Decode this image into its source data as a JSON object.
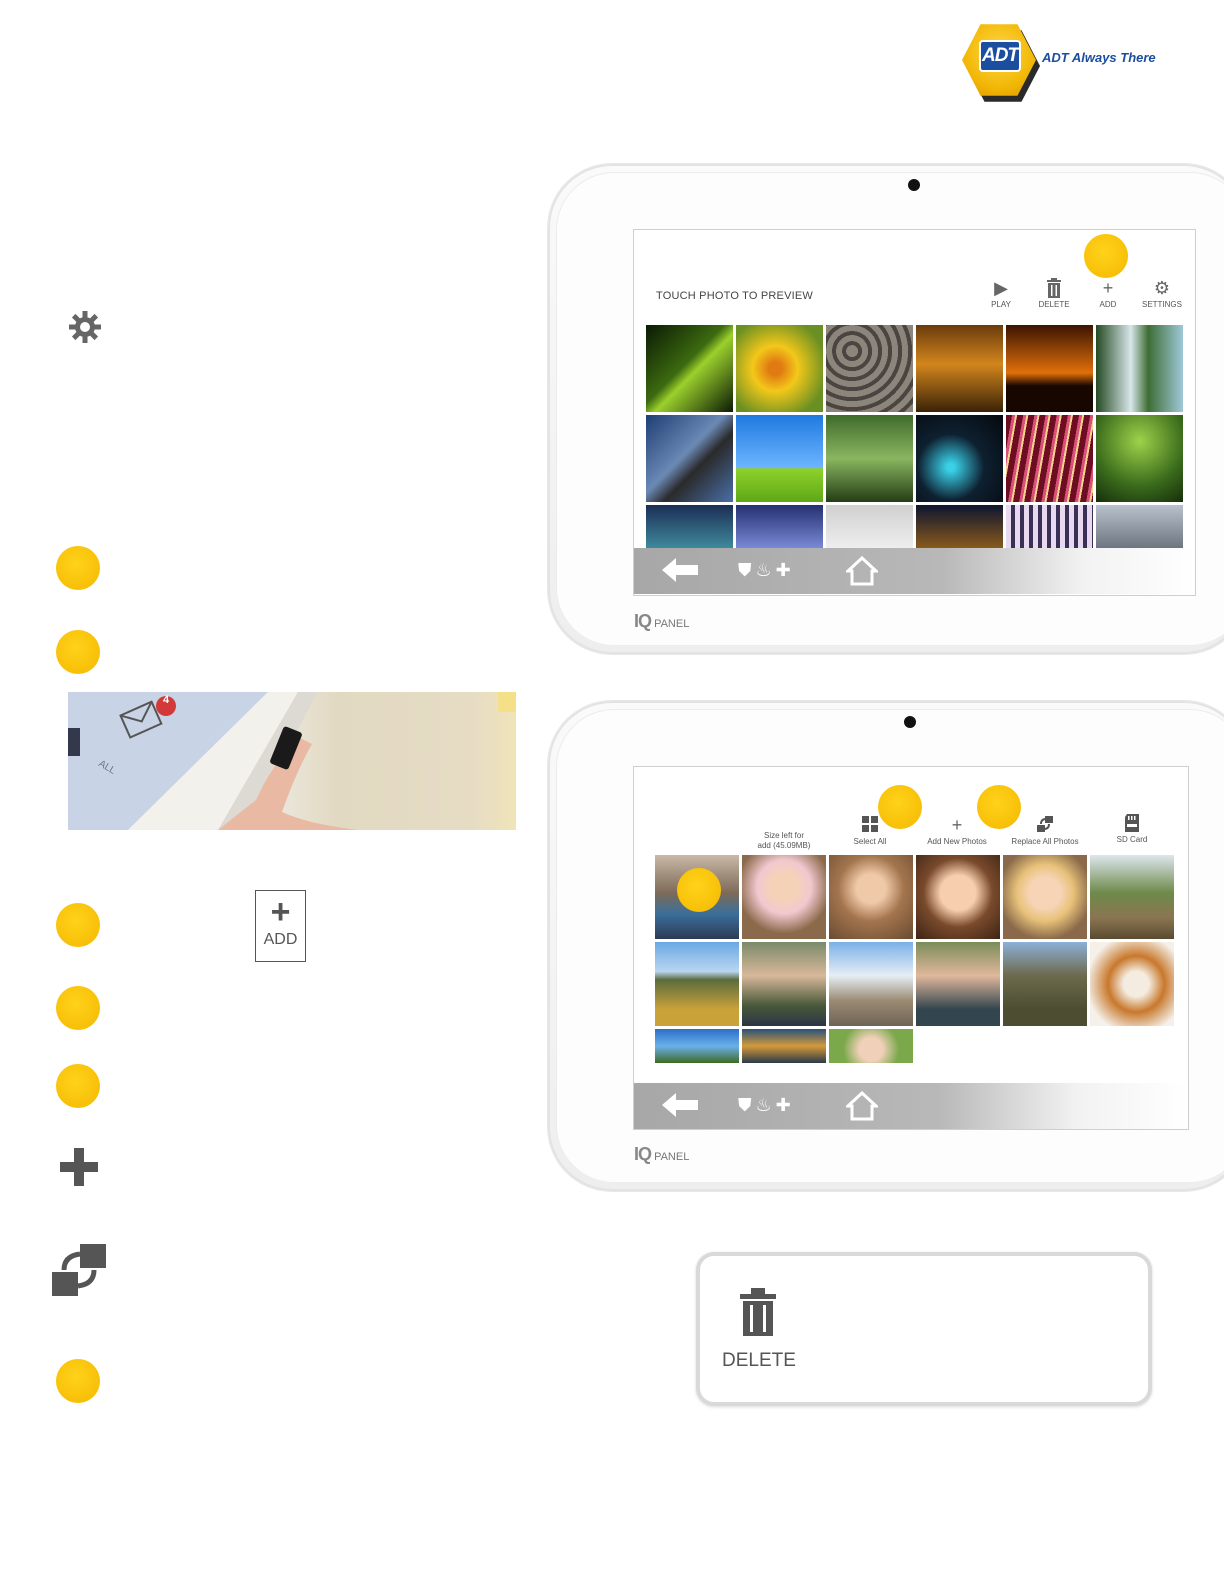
{
  "logo": {
    "badge": "ADT",
    "tagline": "ADT Always There"
  },
  "device1": {
    "brand_iq": "IQ",
    "brand_panel": "PANEL",
    "title": "TOUCH PHOTO TO PREVIEW",
    "toolbar": [
      {
        "icon": "play-icon",
        "label": "PLAY"
      },
      {
        "icon": "trash-icon",
        "label": "DELETE"
      },
      {
        "icon": "plus-icon",
        "label": "ADD"
      },
      {
        "icon": "gear-icon",
        "label": "SETTINGS"
      }
    ]
  },
  "device2": {
    "brand_iq": "IQ",
    "brand_panel": "PANEL",
    "size_left_line1": "Size left for",
    "size_left_line2": "add (45.09MB)",
    "toolbar": [
      {
        "icon": "select-all-icon",
        "label": "Select All"
      },
      {
        "icon": "plus-icon",
        "label": "Add New Photos"
      },
      {
        "icon": "replace-icon",
        "label": "Replace All Photos"
      },
      {
        "icon": "sd-card-icon",
        "label": "SD Card"
      }
    ]
  },
  "photo": {
    "badge_count": "4",
    "tag": "ALL"
  },
  "add_button": {
    "label": "ADD"
  },
  "delete_card": {
    "label": "DELETE"
  },
  "colors": {
    "accent_yellow": "#f5b800",
    "adt_blue": "#1c4ea0"
  }
}
